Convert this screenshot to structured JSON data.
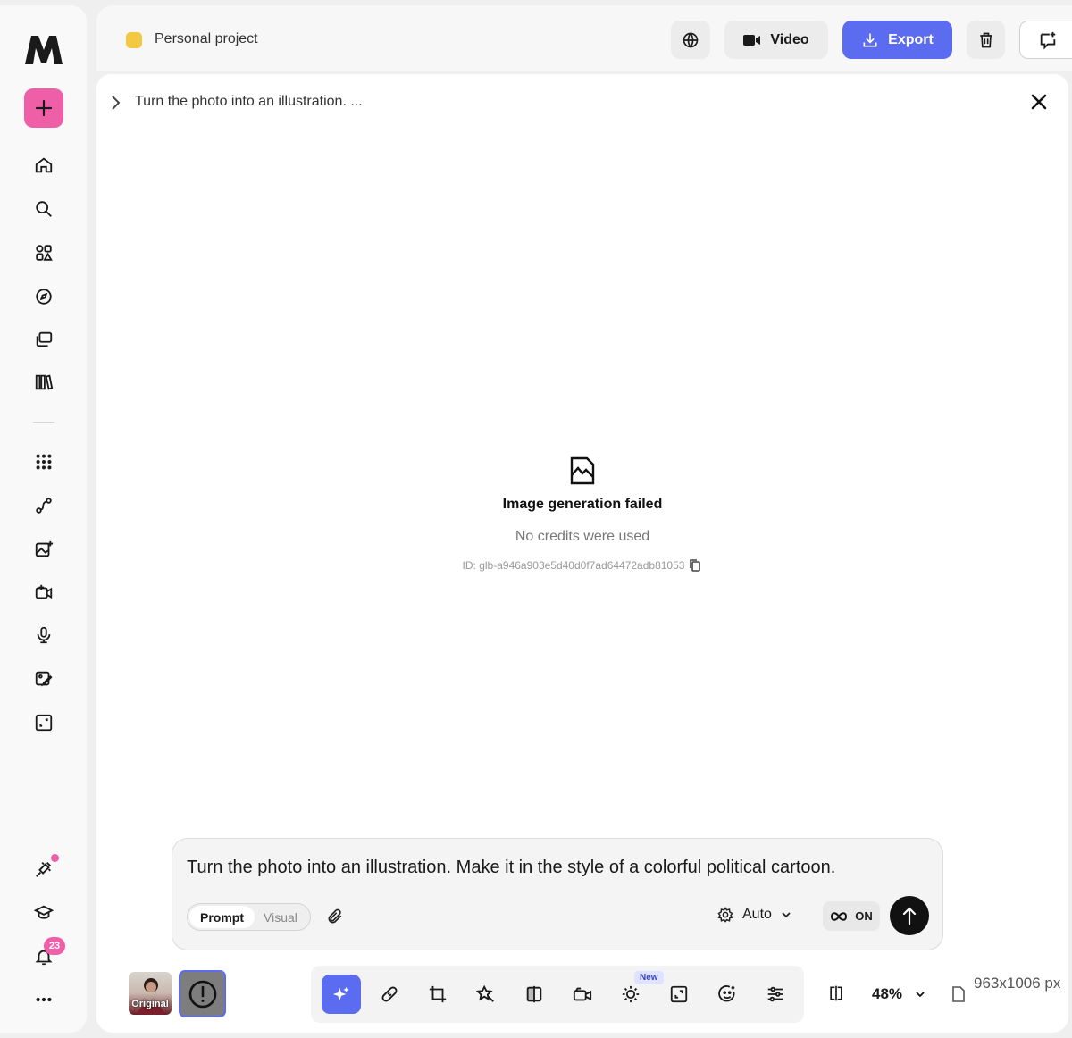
{
  "header": {
    "project_name": "Personal project",
    "video_label": "Video",
    "export_label": "Export"
  },
  "main": {
    "breadcrumb": "Turn the photo into an illustration. ...",
    "fail_title": "Image generation failed",
    "fail_subtitle": "No credits were used",
    "fail_id": "ID: glb-a946a903e5d40d0f7ad64472adb81053"
  },
  "prompt": {
    "text": "Turn the photo into an illustration. Make it in the style of a colorful political cartoon.",
    "mode_prompt": "Prompt",
    "mode_visual": "Visual",
    "model_label": "Auto",
    "loop_label": "ON"
  },
  "sidebar": {
    "notifications_count": "23"
  },
  "bottom": {
    "thumb_original_label": "Original",
    "new_badge": "New",
    "zoom": "48%",
    "dimensions": "963x1006 px"
  },
  "colors": {
    "accent": "#5b6cf0",
    "pink": "#ef5fa7",
    "project": "#f5c842"
  },
  "icons": [
    "logo-icon",
    "plus-icon",
    "home-icon",
    "search-icon",
    "apps-icon",
    "compass-icon",
    "gallery-icon",
    "library-icon",
    "grid-icon",
    "flow-icon",
    "image-plus-icon",
    "video-plus-icon",
    "mic-icon",
    "image-edit-icon",
    "expand-icon",
    "plugin-icon",
    "graduation-icon",
    "bell-icon",
    "more-icon",
    "globe-icon",
    "video-icon",
    "download-icon",
    "trash-icon",
    "chat-plus-icon",
    "chevron-right-icon",
    "close-icon",
    "image-broken-icon",
    "copy-icon",
    "paperclip-icon",
    "gear-icon",
    "chevron-down-icon",
    "infinity-icon",
    "arrow-up-icon",
    "sparkle-icon",
    "bandage-icon",
    "crop-icon",
    "star-wand-icon",
    "flip-icon",
    "camera-icon",
    "sun-icon",
    "resize-icon",
    "face-icon",
    "sliders-icon",
    "split-icon",
    "document-icon",
    "alert-icon"
  ]
}
